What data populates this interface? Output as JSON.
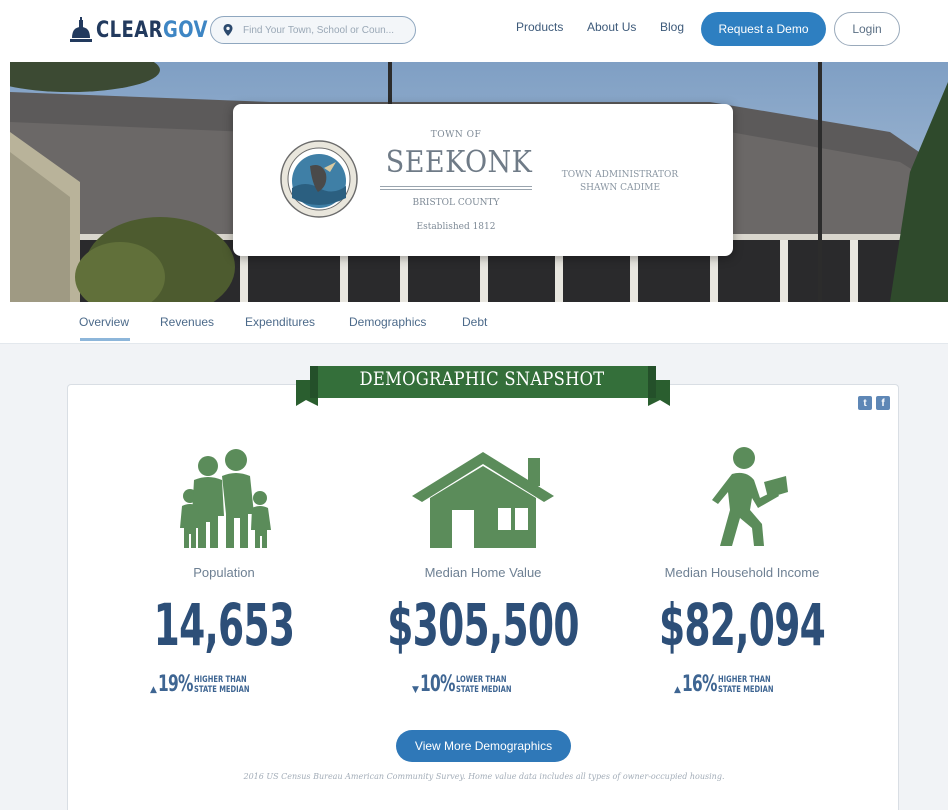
{
  "header": {
    "logo": {
      "clear": "CLEAR",
      "gov": "GOV"
    },
    "search_placeholder": "Find Your Town, School or Coun...",
    "nav": [
      "Products",
      "About Us",
      "Blog"
    ],
    "demo_button": "Request a Demo",
    "login_button": "Login"
  },
  "hero": {
    "town_prefix": "TOWN OF",
    "town_name": "SEEKONK",
    "county": "BRISTOL COUNTY",
    "established": "Established 1812",
    "admin_title": "TOWN ADMINISTRATOR",
    "admin_name": "SHAWN CADIME"
  },
  "tabs": [
    "Overview",
    "Revenues",
    "Expenditures",
    "Demographics",
    "Debt"
  ],
  "active_tab": "Overview",
  "snapshot": {
    "title": "DEMOGRAPHIC SNAPSHOT",
    "share": [
      "twitter-icon",
      "facebook-icon"
    ],
    "stats": [
      {
        "label": "Population",
        "value": "14,653",
        "direction": "▲",
        "pct": "19%",
        "line1": "HIGHER THAN",
        "line2": "STATE MEDIAN",
        "icon": "family-icon"
      },
      {
        "label": "Median Home Value",
        "value": "$305,500",
        "direction": "▼",
        "pct": "10%",
        "line1": "LOWER THAN",
        "line2": "STATE MEDIAN",
        "icon": "house-icon"
      },
      {
        "label": "Median Household Income",
        "value": "$82,094",
        "direction": "▲",
        "pct": "16%",
        "line1": "HIGHER THAN",
        "line2": "STATE MEDIAN",
        "icon": "worker-icon"
      }
    ],
    "more_button": "View More Demographics",
    "footnote": "2016 US Census Bureau American Community Survey. Home value data includes all types of owner-occupied housing."
  },
  "colors": {
    "brand_navy": "#223a5e",
    "brand_blue": "#2e7fc1",
    "icon_green": "#5b8c5a",
    "ribbon_green": "#2f6b35",
    "stat_navy": "#2d4f78"
  }
}
